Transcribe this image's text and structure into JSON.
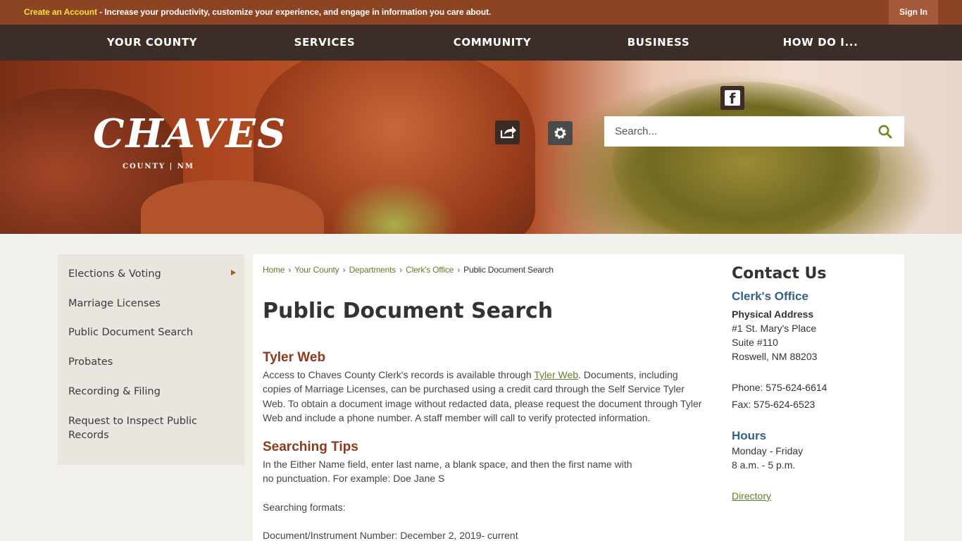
{
  "topbar": {
    "create_account": "Create an Account",
    "message": " - Increase your productivity, customize your experience, and engage in information you care about.",
    "sign_in": "Sign In"
  },
  "nav": {
    "items": [
      "YOUR COUNTY",
      "SERVICES",
      "COMMUNITY",
      "BUSINESS",
      "HOW DO I..."
    ]
  },
  "logo": {
    "name": "CHAVES",
    "subtitle": "COUNTY | NM"
  },
  "search": {
    "placeholder": "Search..."
  },
  "icons": {
    "facebook": "facebook-icon",
    "share": "share-icon",
    "gear": "gear-icon",
    "search": "search-icon"
  },
  "sidebar": {
    "items": [
      {
        "label": "Elections & Voting",
        "has_submenu": true
      },
      {
        "label": "Marriage Licenses"
      },
      {
        "label": "Public Document Search"
      },
      {
        "label": "Probates"
      },
      {
        "label": "Recording & Filing"
      },
      {
        "label": "Request to Inspect Public Records"
      }
    ]
  },
  "breadcrumb": {
    "home": "Home",
    "your_county": "Your County",
    "departments": "Departments",
    "clerks_office": "Clerk's Office",
    "current": "Public Document Search",
    "sep": "›"
  },
  "page": {
    "title": "Public Document Search",
    "section1_heading": "Tyler Web",
    "section1_text_pre": "Access to Chaves County Clerk's records is available through ",
    "section1_link": "Tyler Web",
    "section1_text_post": ". Documents, including copies of Marriage Licenses, can be purchased using a credit card through the Self Service Tyler Web. To obtain a document image without redacted data, please request the document through Tyler Web and include a phone number. A staff member will call to verify protected information.",
    "section2_heading": "Searching Tips",
    "tips_line1": "In the Either Name field, enter last name, a blank space, and then the first name with",
    "tips_line2": "no punctuation. For example: Doe Jane S",
    "formats_label": "Searching formats:",
    "format_line": "Document/Instrument Number: December 2, 2019- current"
  },
  "contact": {
    "title": "Contact Us",
    "office": "Clerk's Office",
    "address_label": "Physical Address",
    "address1": "#1 St. Mary's Place",
    "address2": "Suite #110",
    "address3": "Roswell, NM 88203",
    "phone": "Phone: 575-624-6614",
    "fax": "Fax: 575-624-6523",
    "hours_label": "Hours",
    "hours_days": "Monday - Friday",
    "hours_time": "8 a.m. - 5 p.m.",
    "directory": "Directory"
  },
  "colors": {
    "topbar": "#8c4422",
    "nav": "#3d2d28",
    "link_green": "#5f7e28",
    "heading_rust": "#8c3a1c",
    "contact_blue": "#356085"
  }
}
